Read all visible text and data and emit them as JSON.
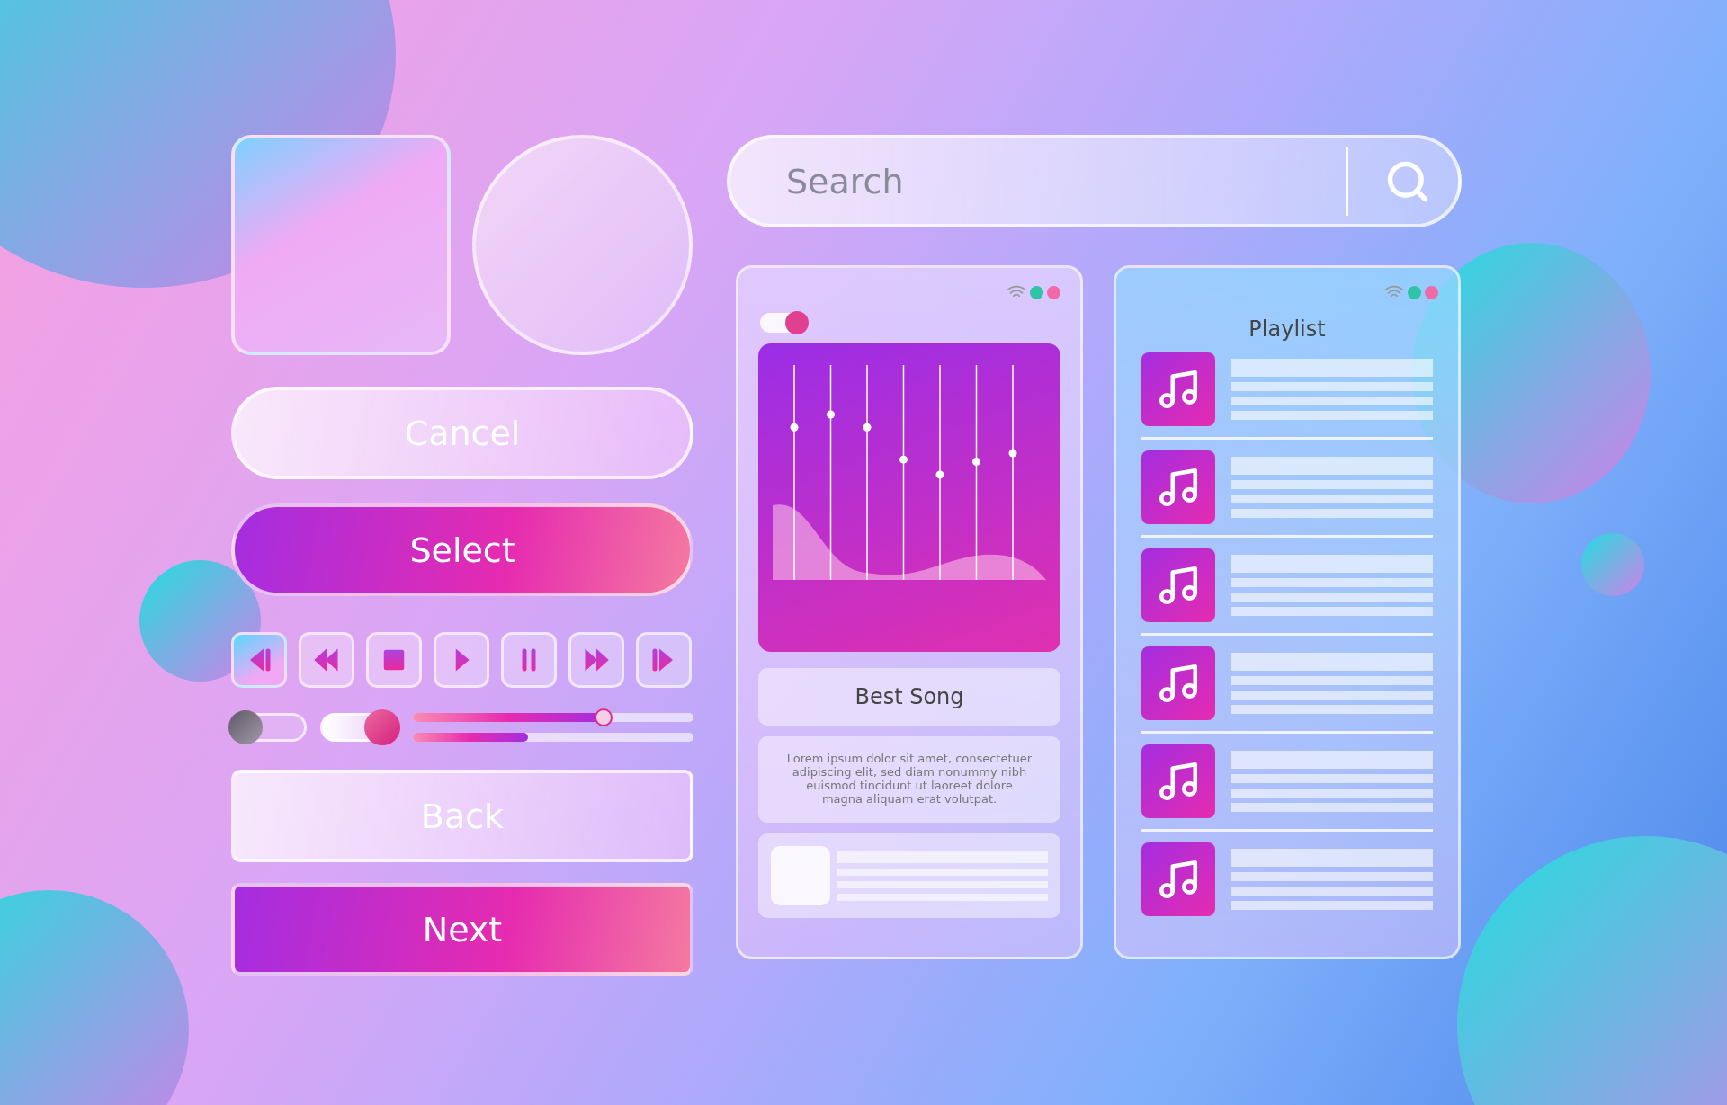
{
  "buttons": [
    {
      "label": "Cancel",
      "kind": "glass-pill"
    },
    {
      "label": "Select",
      "kind": "gradient-pill"
    }
  ],
  "transport": [
    {
      "kind": "skip-back",
      "selected": true
    },
    {
      "kind": "rewind",
      "selected": false
    },
    {
      "kind": "stop",
      "selected": false
    },
    {
      "kind": "play",
      "selected": false
    },
    {
      "kind": "pause",
      "selected": false
    },
    {
      "kind": "fast-forward",
      "selected": false
    },
    {
      "kind": "skip-forward",
      "selected": false
    }
  ],
  "toggles": [
    {
      "on": false
    },
    {
      "on": true
    }
  ],
  "sliders": [
    {
      "level": 0.68
    },
    {
      "level": 0.41
    }
  ],
  "bottom_buttons": [
    {
      "label": "Back",
      "kind": "glass"
    },
    {
      "label": "Next",
      "kind": "gradient"
    }
  ],
  "search": {
    "placeholder": "Search"
  },
  "player": {
    "status_dots": [
      {
        "color": "#2fc3a8"
      },
      {
        "color": "#f06aa8"
      }
    ],
    "toggle_on": true,
    "equalizer": [
      {
        "level": 0.71
      },
      {
        "level": 0.77
      },
      {
        "level": 0.71
      },
      {
        "level": 0.56
      },
      {
        "level": 0.49
      },
      {
        "level": 0.55
      },
      {
        "level": 0.59
      }
    ],
    "song_title": "Best Song",
    "description": "Lorem ipsum dolor sit amet, consectetuer adipiscing elit, sed diam nonummy nibh euismod tincidunt ut laoreet dolore magna aliquam erat volutpat."
  },
  "playlist": {
    "status_dots": [
      {
        "color": "#2fc3a8"
      },
      {
        "color": "#f06aa8"
      }
    ],
    "title": "Playlist",
    "tracks": [
      {
        "kind": "track"
      },
      {
        "kind": "track"
      },
      {
        "kind": "track"
      },
      {
        "kind": "track"
      },
      {
        "kind": "track"
      },
      {
        "kind": "track"
      }
    ]
  }
}
